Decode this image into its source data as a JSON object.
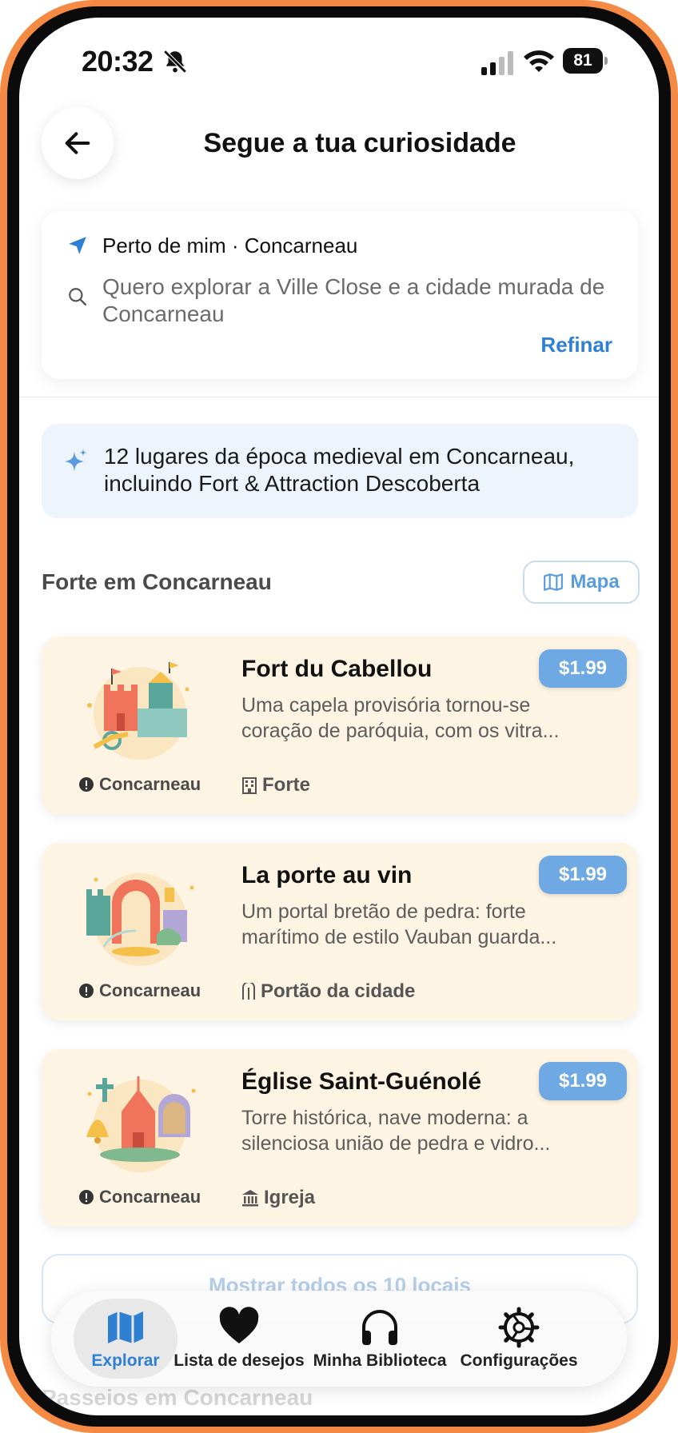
{
  "status_bar": {
    "time": "20:32",
    "battery": "81"
  },
  "header": {
    "title": "Segue a tua curiosidade"
  },
  "search": {
    "location": "Perto de mim · Concarneau",
    "query": "Quero explorar a Ville Close e a cidade murada de Concarneau",
    "refine_label": "Refinar"
  },
  "info_banner": {
    "text": "12 lugares da época medieval em Concarneau, incluindo Fort & Attraction Descoberta"
  },
  "section": {
    "title": "Forte em Concarneau",
    "map_label": "Mapa"
  },
  "places": [
    {
      "title": "Fort du Cabellou",
      "price": "$1.99",
      "description": "Uma capela provisória tornou-se coração de paróquia, com os vitra...",
      "city": "Concarneau",
      "type": "Forte",
      "type_icon": "building-icon"
    },
    {
      "title": "La porte au vin",
      "price": "$1.99",
      "description": "Um portal bretão de pedra: forte marítimo de estilo Vauban guarda...",
      "city": "Concarneau",
      "type": "Portão da cidade",
      "type_icon": "gate-icon"
    },
    {
      "title": "Église Saint-Guénolé",
      "price": "$1.99",
      "description": "Torre histórica, nave moderna: a silenciosa união de pedra e vidro...",
      "city": "Concarneau",
      "type": "Igreja",
      "type_icon": "church-icon"
    }
  ],
  "show_all_label": "Mostrar todos os 10 locais",
  "next_section_title": "Passeios em Concarneau",
  "tabs": [
    {
      "label": "Explorar",
      "icon": "map-icon",
      "active": true
    },
    {
      "label": "Lista de desejos",
      "icon": "heart-icon",
      "active": false
    },
    {
      "label": "Minha Biblioteca",
      "icon": "headphones-icon",
      "active": false
    },
    {
      "label": "Configurações",
      "icon": "gear-icon",
      "active": false
    }
  ],
  "colors": {
    "accent": "#2f7fd3",
    "card_bg": "#fdf4e3",
    "price_badge": "#6fa9e3",
    "frame": "#f58a45"
  }
}
